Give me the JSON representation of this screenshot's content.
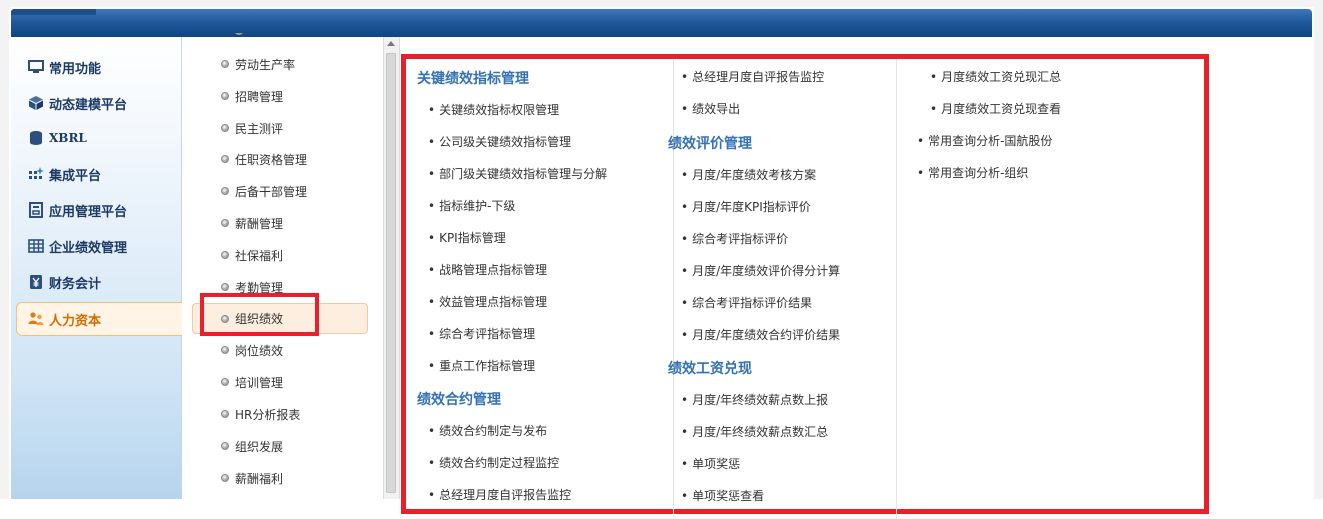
{
  "left_nav": [
    {
      "label": "常用功能",
      "icon": "monitor-icon"
    },
    {
      "label": "动态建模平台",
      "icon": "cube-icon"
    },
    {
      "label": "XBRL",
      "icon": "database-icon"
    },
    {
      "label": "集成平台",
      "icon": "integration-icon"
    },
    {
      "label": "应用管理平台",
      "icon": "app-window-icon"
    },
    {
      "label": "企业绩效管理",
      "icon": "table-grid-icon"
    },
    {
      "label": "财务会计",
      "icon": "finance-icon"
    },
    {
      "label": "人力资本",
      "icon": "people-icon",
      "active": true
    }
  ],
  "sub_menu": [
    {
      "label": "劳动生产率"
    },
    {
      "label": "招聘管理"
    },
    {
      "label": "民主测评"
    },
    {
      "label": "任职资格管理"
    },
    {
      "label": "后备干部管理"
    },
    {
      "label": "薪酬管理"
    },
    {
      "label": "社保福利"
    },
    {
      "label": "考勤管理"
    },
    {
      "label": "组织绩效",
      "active": true
    },
    {
      "label": "岗位绩效"
    },
    {
      "label": "培训管理"
    },
    {
      "label": "HR分析报表"
    },
    {
      "label": "组织发展"
    },
    {
      "label": "薪酬福利"
    }
  ],
  "panel": {
    "col1": {
      "group1_title": "关键绩效指标管理",
      "group1_links": [
        "关键绩效指标权限管理",
        "公司级关键绩效指标管理",
        "部门级关键绩效指标管理与分解",
        "指标维护-下级",
        "KPI指标管理",
        "战略管理点指标管理",
        "效益管理点指标管理",
        "综合考评指标管理",
        "重点工作指标管理"
      ],
      "group2_title": "绩效合约管理",
      "group2_links": [
        "绩效合约制定与发布",
        "绩效合约制定过程监控",
        "总经理月度自评报告监控"
      ]
    },
    "col2": {
      "top_links": [
        "总经理月度自评报告监控",
        "绩效导出"
      ],
      "group1_title": "绩效评价管理",
      "group1_links": [
        "月度/年度绩效考核方案",
        "月度/年度KPI指标评价",
        "综合考评指标评价",
        "月度/年度绩效评价得分计算",
        "综合考评指标评价结果",
        "月度/年度绩效合约评价结果"
      ],
      "group2_title": "绩效工资兑现",
      "group2_links": [
        "月度/年终绩效薪点数上报",
        "月度/年终绩效薪点数汇总",
        "单项奖惩",
        "单项奖惩查看"
      ]
    },
    "col3": {
      "sub_links": [
        "月度绩效工资兑现汇总",
        "月度绩效工资兑现查看"
      ],
      "links": [
        "常用查询分析-国航股份",
        "常用查询分析-组织"
      ]
    }
  },
  "colors": {
    "highlight": "#e8202b",
    "title_blue": "#3471b6",
    "active_orange": "#d36b00",
    "topbar": "#1f5a9c"
  }
}
